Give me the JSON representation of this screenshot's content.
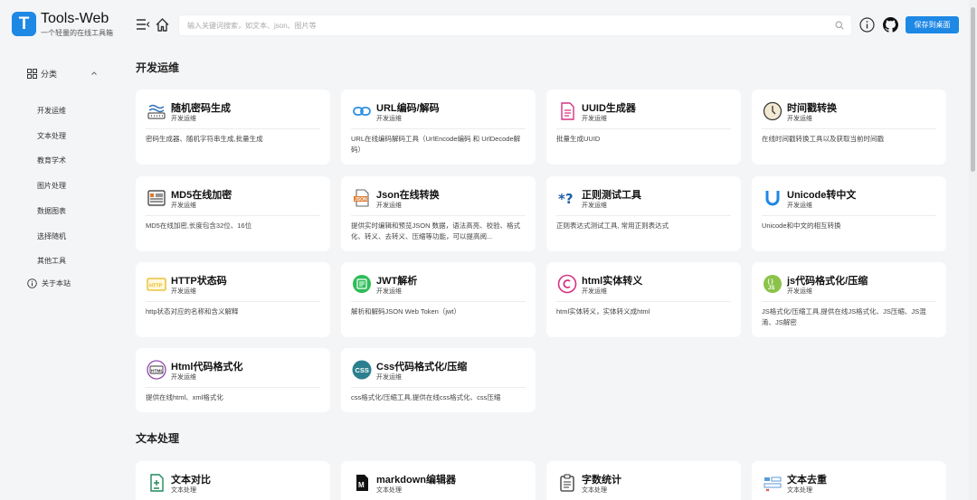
{
  "header": {
    "logo_letter": "T",
    "brand_name": "Tools-Web",
    "brand_sub": "一个轻量的在线工具箱",
    "search_placeholder": "输入关键词搜索，如文本、json、图片等",
    "save_label": "保存到桌面"
  },
  "sidebar": {
    "category_label": "分类",
    "items": [
      "开发运维",
      "文本处理",
      "教育学术",
      "图片处理",
      "数据图表",
      "选择随机",
      "其他工具"
    ],
    "about_label": "关于本站"
  },
  "sections": [
    {
      "title": "开发运维",
      "cards": [
        {
          "title": "随机密码生成",
          "category": "开发运维",
          "desc": "密码生成器、随机字符串生成,批量生成",
          "icon": "password-icon"
        },
        {
          "title": "URL编码/解码",
          "category": "开发运维",
          "desc": "URL在线编码解码工具（UrlEncode编码 和 UrlDecode解码）",
          "icon": "link-icon"
        },
        {
          "title": "UUID生成器",
          "category": "开发运维",
          "desc": "批量生成UUID",
          "icon": "document-icon"
        },
        {
          "title": "时间戳转换",
          "category": "开发运维",
          "desc": "在线时间戳转换工具以及获取当前时间戳",
          "icon": "clock-icon"
        },
        {
          "title": "MD5在线加密",
          "category": "开发运维",
          "desc": "MD5在线加密,长度包含32位、16位",
          "icon": "md5-icon"
        },
        {
          "title": "Json在线转换",
          "category": "开发运维",
          "desc": "提供实时编辑和预览JSON 数据，语法高亮、校验、格式化、转义、去转义、压缩等功能，可以提高阅...",
          "icon": "json-file-icon"
        },
        {
          "title": "正则测试工具",
          "category": "开发运维",
          "desc": "正则表达式测试工具, 常用正则表达式",
          "icon": "regex-icon"
        },
        {
          "title": "Unicode转中文",
          "category": "开发运维",
          "desc": "Unicode和中文的相互转换",
          "icon": "unicode-icon"
        },
        {
          "title": "HTTP状态码",
          "category": "开发运维",
          "desc": "http状态对应的名称和含义解释",
          "icon": "http-icon"
        },
        {
          "title": "JWT解析",
          "category": "开发运维",
          "desc": "解析和解码JSON Web Token（jwt）",
          "icon": "jwt-icon"
        },
        {
          "title": "html实体转义",
          "category": "开发运维",
          "desc": "html实体转义，实体转义成html",
          "icon": "copyright-icon"
        },
        {
          "title": "js代码格式化/压缩",
          "category": "开发运维",
          "desc": "JS格式化/压缩工具,提供在线JS格式化、JS压缩、JS混淆、JS解密",
          "icon": "js-icon"
        },
        {
          "title": "Html代码格式化",
          "category": "开发运维",
          "desc": "提供在线html、xml格式化",
          "icon": "html-icon"
        },
        {
          "title": "Css代码格式化/压缩",
          "category": "开发运维",
          "desc": "css格式化/压缩工具,提供在线css格式化、css压缩",
          "icon": "css-icon"
        }
      ]
    },
    {
      "title": "文本处理",
      "cards": [
        {
          "title": "文本对比",
          "category": "文本处理",
          "desc": "",
          "icon": "diff-icon"
        },
        {
          "title": "markdown编辑器",
          "category": "文本处理",
          "desc": "",
          "icon": "markdown-icon"
        },
        {
          "title": "字数统计",
          "category": "文本处理",
          "desc": "",
          "icon": "clipboard-icon"
        },
        {
          "title": "文本去重",
          "category": "文本处理",
          "desc": "",
          "icon": "dedupe-icon"
        }
      ]
    }
  ],
  "colors": {
    "accent": "#1e88e5",
    "background": "#f4f5f7",
    "card": "#ffffff"
  }
}
